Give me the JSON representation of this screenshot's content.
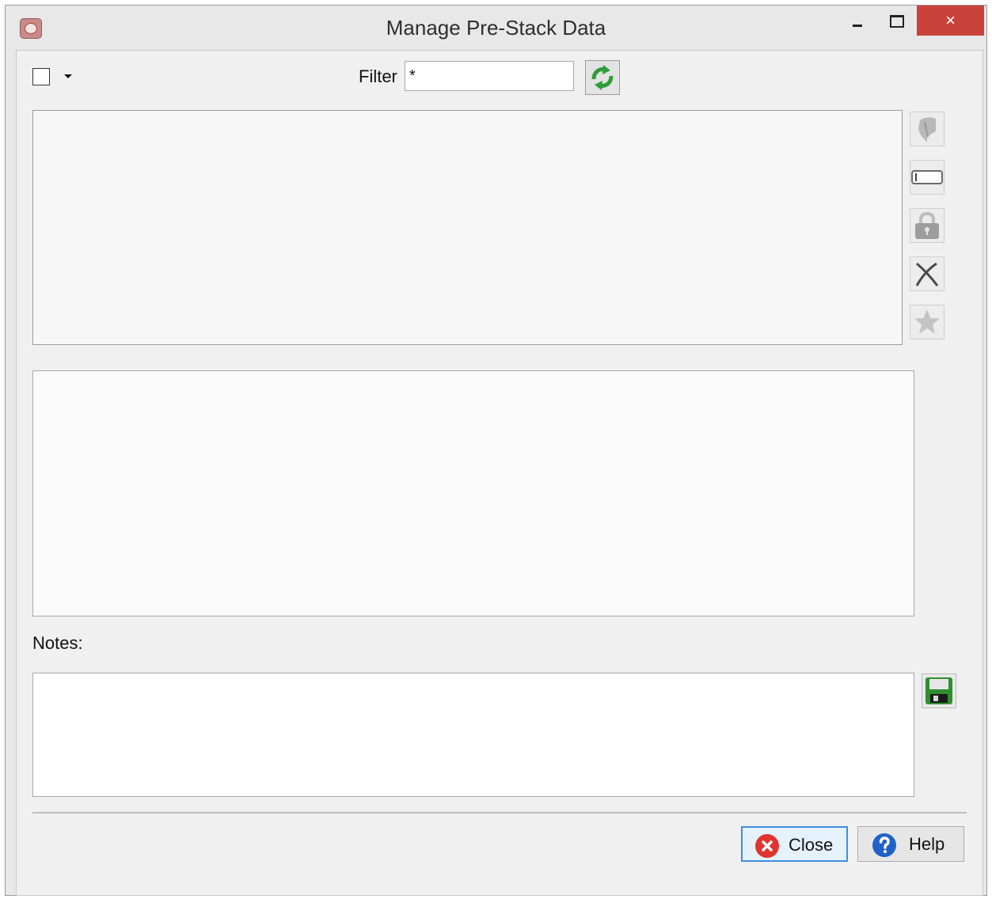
{
  "window": {
    "title": "Manage Pre-Stack Data",
    "controls": {
      "minimize": "minimize",
      "maximize": "maximize",
      "close": "×"
    }
  },
  "toolbar": {
    "select_all_checked": false,
    "filter_label": "Filter",
    "filter_value": "*"
  },
  "side_buttons": [
    {
      "icon": "dataset-icon",
      "enabled": false
    },
    {
      "icon": "rename-icon",
      "enabled": true
    },
    {
      "icon": "lock-icon",
      "enabled": false
    },
    {
      "icon": "delete-icon",
      "enabled": true
    },
    {
      "icon": "default-star-icon",
      "enabled": false
    }
  ],
  "notes": {
    "label": "Notes:",
    "value": ""
  },
  "footer": {
    "close_label": "Close",
    "help_label": "Help"
  },
  "colors": {
    "title_close_button": "#c9433b",
    "focus_border": "#3c8ede",
    "refresh_green": "#2e9d3a",
    "save_green": "#2f8f2f"
  }
}
